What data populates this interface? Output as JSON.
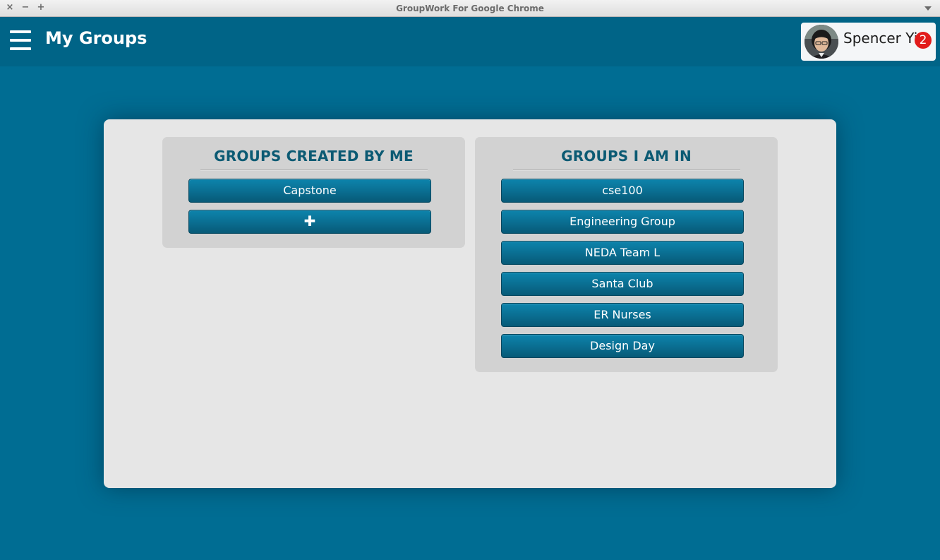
{
  "window": {
    "title": "GroupWork For Google Chrome",
    "controls": {
      "close": "×",
      "minimize": "−",
      "maximize": "+"
    }
  },
  "header": {
    "menu_icon": "hamburger-menu-icon",
    "title": "My Groups",
    "user": {
      "name": "Spencer Yi",
      "avatar_icon": "user-avatar",
      "notification_count": "2",
      "badge_color": "#e21b1b"
    }
  },
  "main": {
    "created_panel": {
      "heading": "GROUPS CREATED BY ME",
      "groups": [
        "Capstone"
      ],
      "add_label": "✚"
    },
    "member_panel": {
      "heading": "GROUPS I AM IN",
      "groups": [
        "cse100",
        "Engineering Group",
        "NEDA Team L",
        "Santa Club",
        "ER Nurses",
        "Design Day"
      ]
    }
  },
  "colors": {
    "background": "#006d93",
    "header": "#006487",
    "heading_text": "#0b5a73",
    "button": "#0a6d90"
  }
}
